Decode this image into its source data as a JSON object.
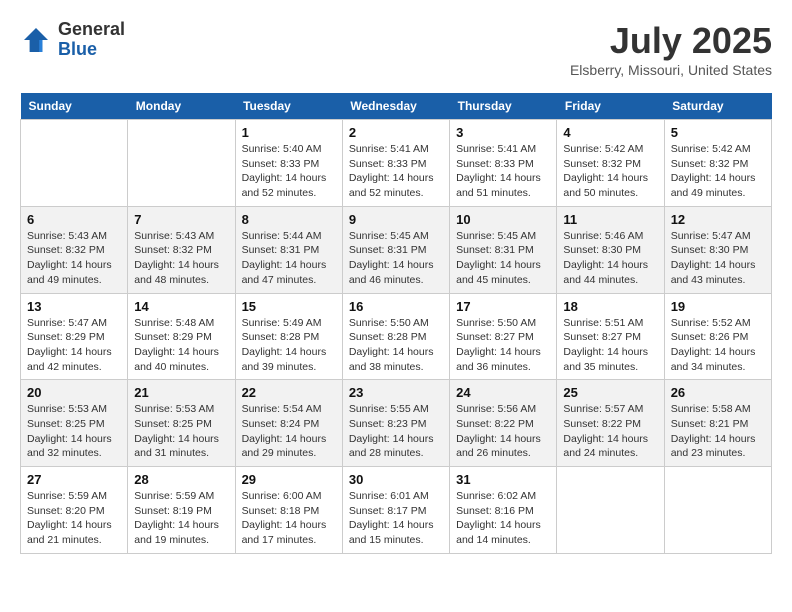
{
  "header": {
    "logo_line1": "General",
    "logo_line2": "Blue",
    "month": "July 2025",
    "location": "Elsberry, Missouri, United States"
  },
  "days_of_week": [
    "Sunday",
    "Monday",
    "Tuesday",
    "Wednesday",
    "Thursday",
    "Friday",
    "Saturday"
  ],
  "weeks": [
    [
      {
        "day": "",
        "info": ""
      },
      {
        "day": "",
        "info": ""
      },
      {
        "day": "1",
        "info": "Sunrise: 5:40 AM\nSunset: 8:33 PM\nDaylight: 14 hours and 52 minutes."
      },
      {
        "day": "2",
        "info": "Sunrise: 5:41 AM\nSunset: 8:33 PM\nDaylight: 14 hours and 52 minutes."
      },
      {
        "day": "3",
        "info": "Sunrise: 5:41 AM\nSunset: 8:33 PM\nDaylight: 14 hours and 51 minutes."
      },
      {
        "day": "4",
        "info": "Sunrise: 5:42 AM\nSunset: 8:32 PM\nDaylight: 14 hours and 50 minutes."
      },
      {
        "day": "5",
        "info": "Sunrise: 5:42 AM\nSunset: 8:32 PM\nDaylight: 14 hours and 49 minutes."
      }
    ],
    [
      {
        "day": "6",
        "info": "Sunrise: 5:43 AM\nSunset: 8:32 PM\nDaylight: 14 hours and 49 minutes."
      },
      {
        "day": "7",
        "info": "Sunrise: 5:43 AM\nSunset: 8:32 PM\nDaylight: 14 hours and 48 minutes."
      },
      {
        "day": "8",
        "info": "Sunrise: 5:44 AM\nSunset: 8:31 PM\nDaylight: 14 hours and 47 minutes."
      },
      {
        "day": "9",
        "info": "Sunrise: 5:45 AM\nSunset: 8:31 PM\nDaylight: 14 hours and 46 minutes."
      },
      {
        "day": "10",
        "info": "Sunrise: 5:45 AM\nSunset: 8:31 PM\nDaylight: 14 hours and 45 minutes."
      },
      {
        "day": "11",
        "info": "Sunrise: 5:46 AM\nSunset: 8:30 PM\nDaylight: 14 hours and 44 minutes."
      },
      {
        "day": "12",
        "info": "Sunrise: 5:47 AM\nSunset: 8:30 PM\nDaylight: 14 hours and 43 minutes."
      }
    ],
    [
      {
        "day": "13",
        "info": "Sunrise: 5:47 AM\nSunset: 8:29 PM\nDaylight: 14 hours and 42 minutes."
      },
      {
        "day": "14",
        "info": "Sunrise: 5:48 AM\nSunset: 8:29 PM\nDaylight: 14 hours and 40 minutes."
      },
      {
        "day": "15",
        "info": "Sunrise: 5:49 AM\nSunset: 8:28 PM\nDaylight: 14 hours and 39 minutes."
      },
      {
        "day": "16",
        "info": "Sunrise: 5:50 AM\nSunset: 8:28 PM\nDaylight: 14 hours and 38 minutes."
      },
      {
        "day": "17",
        "info": "Sunrise: 5:50 AM\nSunset: 8:27 PM\nDaylight: 14 hours and 36 minutes."
      },
      {
        "day": "18",
        "info": "Sunrise: 5:51 AM\nSunset: 8:27 PM\nDaylight: 14 hours and 35 minutes."
      },
      {
        "day": "19",
        "info": "Sunrise: 5:52 AM\nSunset: 8:26 PM\nDaylight: 14 hours and 34 minutes."
      }
    ],
    [
      {
        "day": "20",
        "info": "Sunrise: 5:53 AM\nSunset: 8:25 PM\nDaylight: 14 hours and 32 minutes."
      },
      {
        "day": "21",
        "info": "Sunrise: 5:53 AM\nSunset: 8:25 PM\nDaylight: 14 hours and 31 minutes."
      },
      {
        "day": "22",
        "info": "Sunrise: 5:54 AM\nSunset: 8:24 PM\nDaylight: 14 hours and 29 minutes."
      },
      {
        "day": "23",
        "info": "Sunrise: 5:55 AM\nSunset: 8:23 PM\nDaylight: 14 hours and 28 minutes."
      },
      {
        "day": "24",
        "info": "Sunrise: 5:56 AM\nSunset: 8:22 PM\nDaylight: 14 hours and 26 minutes."
      },
      {
        "day": "25",
        "info": "Sunrise: 5:57 AM\nSunset: 8:22 PM\nDaylight: 14 hours and 24 minutes."
      },
      {
        "day": "26",
        "info": "Sunrise: 5:58 AM\nSunset: 8:21 PM\nDaylight: 14 hours and 23 minutes."
      }
    ],
    [
      {
        "day": "27",
        "info": "Sunrise: 5:59 AM\nSunset: 8:20 PM\nDaylight: 14 hours and 21 minutes."
      },
      {
        "day": "28",
        "info": "Sunrise: 5:59 AM\nSunset: 8:19 PM\nDaylight: 14 hours and 19 minutes."
      },
      {
        "day": "29",
        "info": "Sunrise: 6:00 AM\nSunset: 8:18 PM\nDaylight: 14 hours and 17 minutes."
      },
      {
        "day": "30",
        "info": "Sunrise: 6:01 AM\nSunset: 8:17 PM\nDaylight: 14 hours and 15 minutes."
      },
      {
        "day": "31",
        "info": "Sunrise: 6:02 AM\nSunset: 8:16 PM\nDaylight: 14 hours and 14 minutes."
      },
      {
        "day": "",
        "info": ""
      },
      {
        "day": "",
        "info": ""
      }
    ]
  ]
}
